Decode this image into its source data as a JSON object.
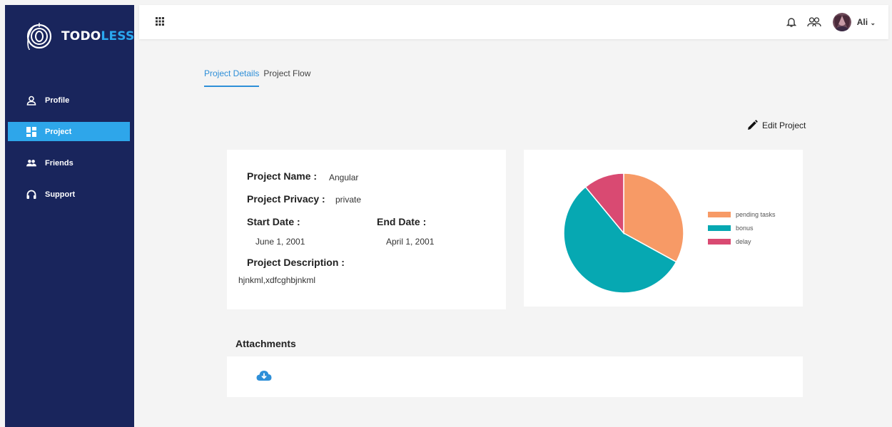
{
  "app": {
    "brand_part1": "TODO",
    "brand_part2": "LESS"
  },
  "sidebar": {
    "items": [
      {
        "label": "Profile",
        "icon": "user-icon"
      },
      {
        "label": "Project",
        "icon": "dashboard-icon",
        "active": true
      },
      {
        "label": "Friends",
        "icon": "people-icon"
      },
      {
        "label": "Support",
        "icon": "headset-icon"
      }
    ]
  },
  "topbar": {
    "user_name": "Ali",
    "icons": [
      "apps-grid-icon",
      "bell-icon",
      "users-icon",
      "avatar"
    ]
  },
  "tabs": [
    {
      "label": "Project Details",
      "active": true
    },
    {
      "label": "Project Flow",
      "active": false
    }
  ],
  "actions": {
    "edit_label": "Edit Project"
  },
  "details": {
    "name_label": "Project Name :",
    "name_value": "Angular",
    "privacy_label": "Project Privacy :",
    "privacy_value": "private",
    "start_label": "Start Date :",
    "start_value": "June 1, 2001",
    "end_label": "End Date :",
    "end_value": "April 1, 2001",
    "description_label": "Project Description :",
    "description_value": "hjnkml,xdfcghbjnkml"
  },
  "attachments": {
    "title": "Attachments"
  },
  "colors": {
    "sidebar_bg": "#19255c",
    "active_nav": "#2ea6ea",
    "accent": "#2e8fd8"
  },
  "chart_data": {
    "type": "pie",
    "title": "",
    "series": [
      {
        "name": "pending tasks",
        "value": 33,
        "color": "#f79a66"
      },
      {
        "name": "bonus",
        "value": 56,
        "color": "#06a8b2"
      },
      {
        "name": "delay",
        "value": 11,
        "color": "#d94a72"
      }
    ],
    "legend": "right"
  }
}
